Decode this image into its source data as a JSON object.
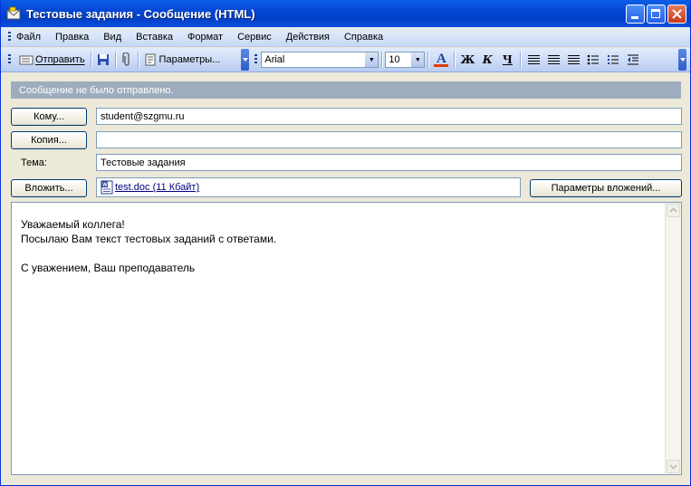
{
  "window": {
    "title": "Тестовые задания - Сообщение (HTML)",
    "icons": {
      "app": "mail-envelope-icon",
      "minimize": "minimize-icon",
      "maximize": "maximize-icon",
      "close": "close-icon"
    }
  },
  "menu": {
    "items": [
      "Файл",
      "Правка",
      "Вид",
      "Вставка",
      "Формат",
      "Сервис",
      "Действия",
      "Справка"
    ]
  },
  "toolbar": {
    "send_label": "Отправить",
    "options_label": "Параметры...",
    "font_name": "Arial",
    "font_size": "10",
    "font_color_glyph": "A",
    "bold_glyph": "Ж",
    "italic_glyph": "К",
    "underline_glyph": "Ч",
    "accent_color": "#e03c00"
  },
  "info_bar": {
    "text": "Сообщение не было отправлено."
  },
  "form": {
    "to_button": "Кому...",
    "to_value": "student@szgmu.ru",
    "cc_button": "Копия...",
    "cc_value": "",
    "subject_label": "Тема:",
    "subject_value": "Тестовые задания",
    "attach_button": "Вложить...",
    "attachment": "test.doc (11 Кбайт)",
    "attach_options_button": "Параметры вложений..."
  },
  "body": {
    "lines": [
      "Уважаемый коллега!",
      "Посылаю Вам текст тестовых заданий с ответами.",
      "",
      "С уважением, Ваш преподаватель"
    ]
  }
}
